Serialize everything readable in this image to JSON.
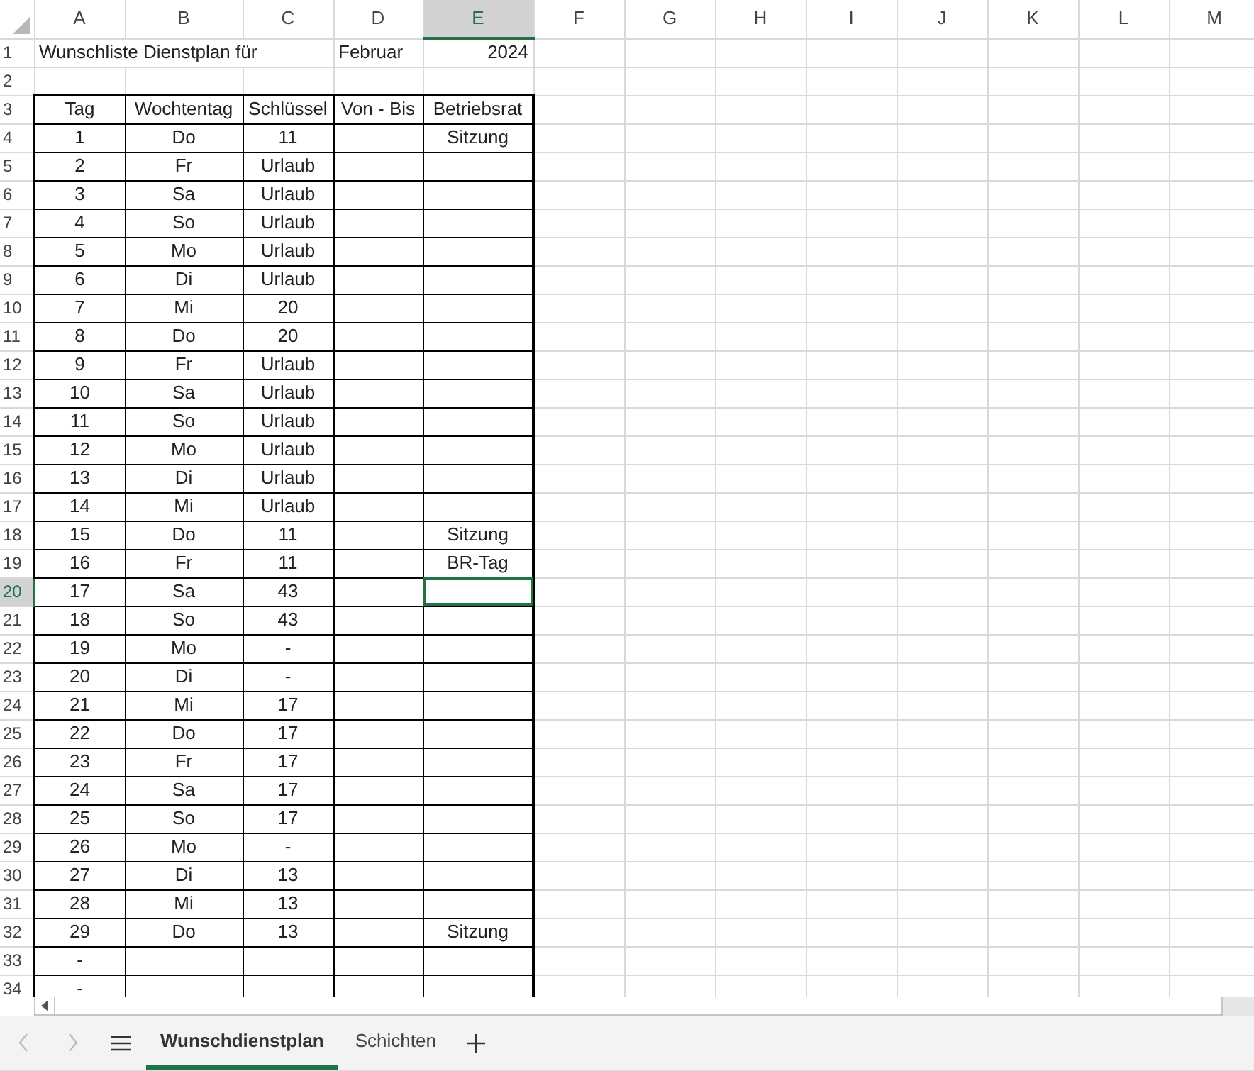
{
  "columns": [
    {
      "label": "A",
      "selected": false
    },
    {
      "label": "B",
      "selected": false
    },
    {
      "label": "C",
      "selected": false
    },
    {
      "label": "D",
      "selected": false
    },
    {
      "label": "E",
      "selected": true
    },
    {
      "label": "F",
      "selected": false
    },
    {
      "label": "G",
      "selected": false
    },
    {
      "label": "H",
      "selected": false
    },
    {
      "label": "I",
      "selected": false
    },
    {
      "label": "J",
      "selected": false
    },
    {
      "label": "K",
      "selected": false
    },
    {
      "label": "L",
      "selected": false
    },
    {
      "label": "M",
      "selected": false
    }
  ],
  "rows": [
    {
      "label": "1",
      "kind": "title",
      "selected": false,
      "cells": [
        "Wunschliste Dienstplan für",
        null,
        null,
        "Februar",
        "2024"
      ]
    },
    {
      "label": "2",
      "kind": "blank",
      "selected": false,
      "cells": [
        null,
        null,
        null,
        null,
        null
      ]
    },
    {
      "label": "3",
      "kind": "table",
      "selected": false,
      "cells": [
        "Tag",
        "Wochtentag",
        "Schlüssel",
        "Von - Bis",
        "Betriebsrat"
      ]
    },
    {
      "label": "4",
      "kind": "table",
      "selected": false,
      "cells": [
        "1",
        "Do",
        "11",
        null,
        "Sitzung"
      ]
    },
    {
      "label": "5",
      "kind": "table",
      "selected": false,
      "cells": [
        "2",
        "Fr",
        "Urlaub",
        null,
        null
      ]
    },
    {
      "label": "6",
      "kind": "table",
      "selected": false,
      "cells": [
        "3",
        "Sa",
        "Urlaub",
        null,
        null
      ]
    },
    {
      "label": "7",
      "kind": "table",
      "selected": false,
      "cells": [
        "4",
        "So",
        "Urlaub",
        null,
        null
      ]
    },
    {
      "label": "8",
      "kind": "table",
      "selected": false,
      "cells": [
        "5",
        "Mo",
        "Urlaub",
        null,
        null
      ]
    },
    {
      "label": "9",
      "kind": "table",
      "selected": false,
      "cells": [
        "6",
        "Di",
        "Urlaub",
        null,
        null
      ]
    },
    {
      "label": "10",
      "kind": "table",
      "selected": false,
      "cells": [
        "7",
        "Mi",
        "20",
        null,
        null
      ]
    },
    {
      "label": "11",
      "kind": "table",
      "selected": false,
      "cells": [
        "8",
        "Do",
        "20",
        null,
        null
      ]
    },
    {
      "label": "12",
      "kind": "table",
      "selected": false,
      "cells": [
        "9",
        "Fr",
        "Urlaub",
        null,
        null
      ]
    },
    {
      "label": "13",
      "kind": "table",
      "selected": false,
      "cells": [
        "10",
        "Sa",
        "Urlaub",
        null,
        null
      ]
    },
    {
      "label": "14",
      "kind": "table",
      "selected": false,
      "cells": [
        "11",
        "So",
        "Urlaub",
        null,
        null
      ]
    },
    {
      "label": "15",
      "kind": "table",
      "selected": false,
      "cells": [
        "12",
        "Mo",
        "Urlaub",
        null,
        null
      ]
    },
    {
      "label": "16",
      "kind": "table",
      "selected": false,
      "cells": [
        "13",
        "Di",
        "Urlaub",
        null,
        null
      ]
    },
    {
      "label": "17",
      "kind": "table",
      "selected": false,
      "cells": [
        "14",
        "Mi",
        "Urlaub",
        null,
        null
      ]
    },
    {
      "label": "18",
      "kind": "table",
      "selected": false,
      "cells": [
        "15",
        "Do",
        "11",
        null,
        "Sitzung"
      ]
    },
    {
      "label": "19",
      "kind": "table",
      "selected": false,
      "cells": [
        "16",
        "Fr",
        "11",
        null,
        "BR-Tag"
      ]
    },
    {
      "label": "20",
      "kind": "table",
      "selected": true,
      "cells": [
        "17",
        "Sa",
        "43",
        null,
        null
      ]
    },
    {
      "label": "21",
      "kind": "table",
      "selected": false,
      "cells": [
        "18",
        "So",
        "43",
        null,
        null
      ]
    },
    {
      "label": "22",
      "kind": "table",
      "selected": false,
      "cells": [
        "19",
        "Mo",
        "-",
        null,
        null
      ]
    },
    {
      "label": "23",
      "kind": "table",
      "selected": false,
      "cells": [
        "20",
        "Di",
        "-",
        null,
        null
      ]
    },
    {
      "label": "24",
      "kind": "table",
      "selected": false,
      "cells": [
        "21",
        "Mi",
        "17",
        null,
        null
      ]
    },
    {
      "label": "25",
      "kind": "table",
      "selected": false,
      "cells": [
        "22",
        "Do",
        "17",
        null,
        null
      ]
    },
    {
      "label": "26",
      "kind": "table",
      "selected": false,
      "cells": [
        "23",
        "Fr",
        "17",
        null,
        null
      ]
    },
    {
      "label": "27",
      "kind": "table",
      "selected": false,
      "cells": [
        "24",
        "Sa",
        "17",
        null,
        null
      ]
    },
    {
      "label": "28",
      "kind": "table",
      "selected": false,
      "cells": [
        "25",
        "So",
        "17",
        null,
        null
      ]
    },
    {
      "label": "29",
      "kind": "table",
      "selected": false,
      "cells": [
        "26",
        "Mo",
        "-",
        null,
        null
      ]
    },
    {
      "label": "30",
      "kind": "table",
      "selected": false,
      "cells": [
        "27",
        "Di",
        "13",
        null,
        null
      ]
    },
    {
      "label": "31",
      "kind": "table",
      "selected": false,
      "cells": [
        "28",
        "Mi",
        "13",
        null,
        null
      ]
    },
    {
      "label": "32",
      "kind": "table",
      "selected": false,
      "cells": [
        "29",
        "Do",
        "13",
        null,
        "Sitzung"
      ]
    },
    {
      "label": "33",
      "kind": "table",
      "selected": false,
      "cells": [
        "-",
        null,
        null,
        null,
        null
      ]
    },
    {
      "label": "34",
      "kind": "table",
      "selected": false,
      "cells": [
        "-",
        null,
        null,
        null,
        null
      ]
    }
  ],
  "sheet_tabs": [
    {
      "label": "Wunschdienstplan",
      "selected": true
    },
    {
      "label": "Schichten",
      "selected": false
    }
  ]
}
